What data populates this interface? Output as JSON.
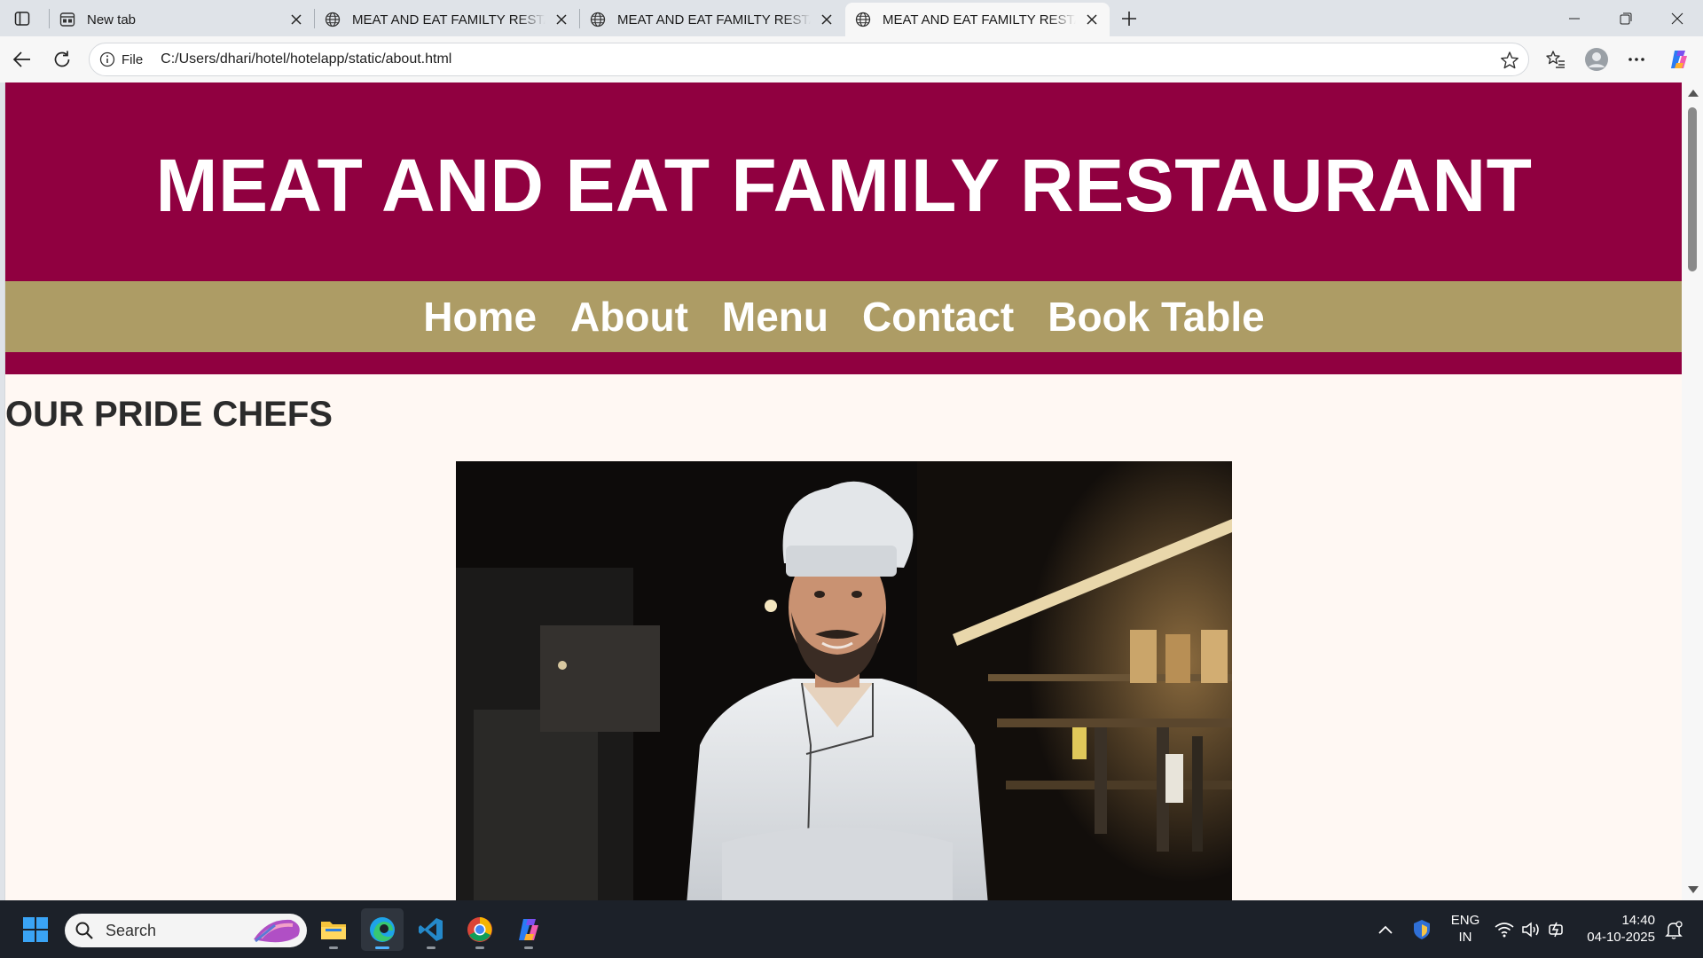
{
  "browser": {
    "tabs": [
      {
        "title": "New tab",
        "icon": "new-tab-page-icon",
        "active": false
      },
      {
        "title": "MEAT AND EAT FAMILTY RESTAURANT",
        "icon": "globe-icon",
        "active": false
      },
      {
        "title": "MEAT AND EAT FAMILTY RESTAURANT",
        "icon": "globe-icon",
        "active": false
      },
      {
        "title": "MEAT AND EAT FAMILTY RESTAURANT",
        "icon": "globe-icon",
        "active": true
      }
    ],
    "address": {
      "scheme_label": "File",
      "url": "C:/Users/dhari/hotel/hotelapp/static/about.html"
    }
  },
  "page": {
    "site_title": "MEAT AND EAT FAMILY RESTAURANT",
    "nav": [
      "Home",
      "About",
      "Menu",
      "Contact",
      "Book Table"
    ],
    "section_title": "OUR PRIDE CHEFS",
    "colors": {
      "header": "#900040",
      "nav": "#ad9c65",
      "background": "#fff8f3"
    }
  },
  "taskbar": {
    "search_placeholder": "Search",
    "language": {
      "line1": "ENG",
      "line2": "IN"
    },
    "clock": {
      "time": "14:40",
      "date": "04-10-2025"
    }
  }
}
